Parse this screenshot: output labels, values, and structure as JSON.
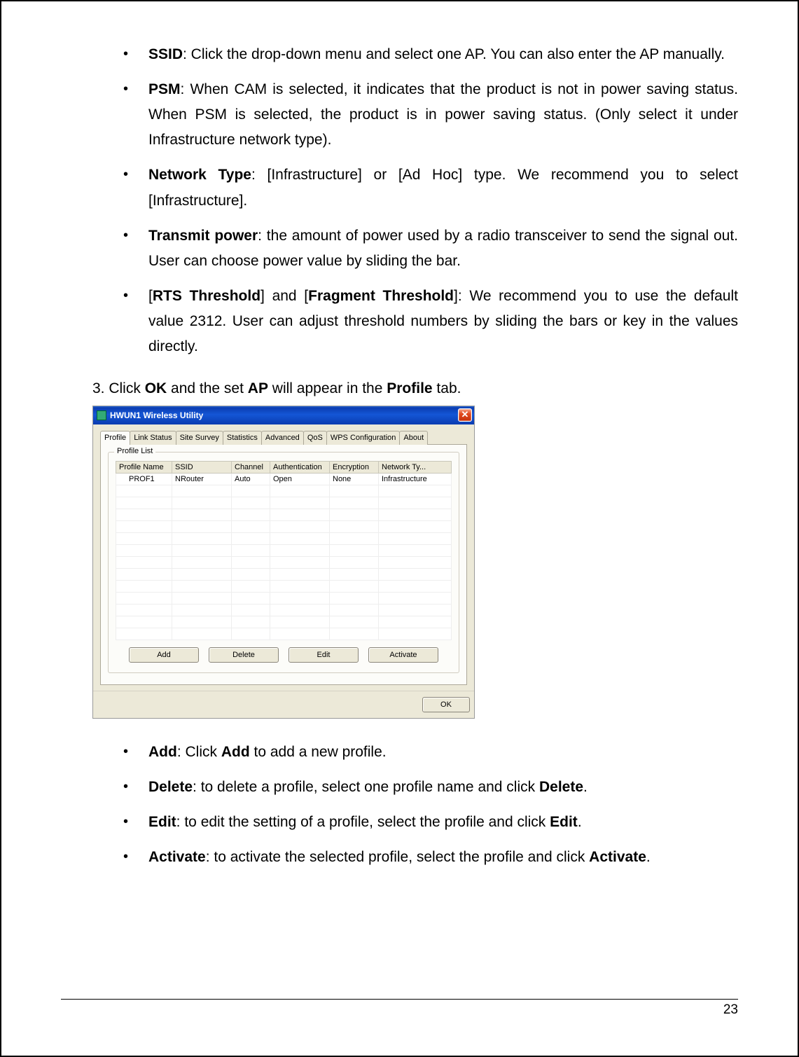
{
  "bullets_top": [
    {
      "term": "SSID",
      "prefix": "",
      "suffix_text": ": Click the drop-down menu and select one AP. You can also enter the AP manually."
    },
    {
      "term": "PSM",
      "prefix": "",
      "suffix_text": ": When CAM is selected, it indicates that the product is not in power saving status. When PSM is selected, the product is in power saving status. (Only select it under Infrastructure network type)."
    },
    {
      "term": "Network Type",
      "prefix": "",
      "suffix_text": ": [Infrastructure] or [Ad Hoc] type. We recommend you to select [Infrastructure]."
    },
    {
      "term": "Transmit power",
      "prefix": "",
      "suffix_text": ": the amount of power used by a radio transceiver to send the signal out. User can choose power value by sliding the bar."
    }
  ],
  "bullet_rts": {
    "open": "[",
    "term1": "RTS Threshold",
    "mid": "] and [",
    "term2": "Fragment Threshold",
    "rest": "]: We recommend you to use the default value 2312. User can adjust threshold numbers by sliding the bars or key in the values directly."
  },
  "step3": {
    "p1": "3. Click ",
    "b1": "OK",
    "p2": " and the set ",
    "b2": "AP",
    "p3": " will appear in the ",
    "b3": "Profile",
    "p4": " tab."
  },
  "dialog": {
    "title": "HWUN1 Wireless Utility",
    "tabs": [
      "Profile",
      "Link Status",
      "Site Survey",
      "Statistics",
      "Advanced",
      "QoS",
      "WPS Configuration",
      "About"
    ],
    "active_tab_index": 0,
    "group_label": "Profile List",
    "columns": [
      "Profile Name",
      "SSID",
      "Channel",
      "Authentication",
      "Encryption",
      "Network Ty..."
    ],
    "rows": [
      {
        "profile_name": "PROF1",
        "ssid": "NRouter",
        "channel": "Auto",
        "auth": "Open",
        "enc": "None",
        "nettype": "Infrastructure"
      }
    ],
    "empty_row_count": 13,
    "buttons": [
      "Add",
      "Delete",
      "Edit",
      "Activate"
    ],
    "ok_label": "OK"
  },
  "bullets_bottom": [
    {
      "term": "Add",
      "mid": ": Click ",
      "bold2": "Add",
      "rest": " to add a new profile."
    },
    {
      "term": "Delete",
      "mid": ": to delete a profile, select one profile name and click ",
      "bold2": "Delete",
      "rest": "."
    },
    {
      "term": "Edit",
      "mid": ": to edit the setting of a profile, select the profile and click ",
      "bold2": "Edit",
      "rest": "."
    },
    {
      "term": "Activate",
      "mid": ": to activate the selected profile, select the profile and click ",
      "bold2": "Activate",
      "rest": "."
    }
  ],
  "page_number": "23"
}
